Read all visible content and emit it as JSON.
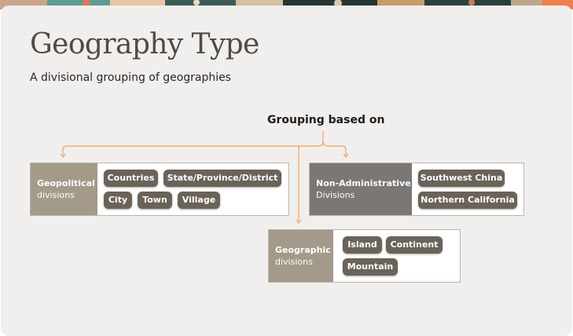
{
  "page": {
    "title": "Geography Type",
    "subtitle": "A divisional grouping of geographies"
  },
  "diagram": {
    "root_label": "Grouping based on",
    "groups": [
      {
        "title": "Geopolitical",
        "subtitle": "divisions",
        "tags": [
          "Countries",
          "State/Province/District",
          "City",
          "Town",
          "Village"
        ]
      },
      {
        "title": "Non-Administrative",
        "subtitle": "Divisions",
        "tags": [
          "Southwest China",
          "Northern California"
        ]
      },
      {
        "title": "Geographic",
        "subtitle": "divisions",
        "tags": [
          "Island",
          "Continent",
          "Mountain"
        ]
      }
    ]
  },
  "colors": {
    "card_background": "#f1efed",
    "connector": "#f0a35e",
    "geopolitical_label_bg": "#a39a89",
    "non_administrative_label_bg": "#7a7775",
    "geographic_label_bg": "#a39a89",
    "tag_bg": "#6b6359"
  }
}
